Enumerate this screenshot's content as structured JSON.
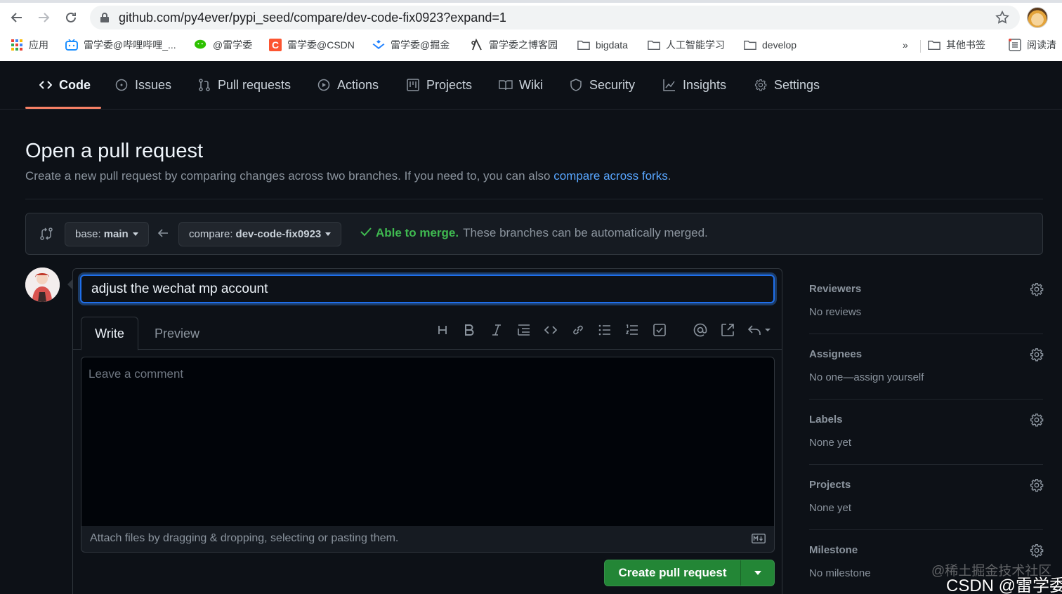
{
  "browser": {
    "url": "github.com/py4ever/pypi_seed/compare/dev-code-fix0923?expand=1",
    "bookmarks": [
      {
        "label": "应用",
        "icon": "apps-grid-icon"
      },
      {
        "label": "雷学委@哔哩哔哩_...",
        "icon": "bilibili-icon"
      },
      {
        "label": "@雷学委",
        "icon": "wechat-icon"
      },
      {
        "label": "雷学委@CSDN",
        "icon": "csdn-icon"
      },
      {
        "label": "雷学委@掘金",
        "icon": "juejin-icon"
      },
      {
        "label": "雷学委之博客园",
        "icon": "cnblogs-icon"
      },
      {
        "label": "bigdata",
        "icon": "folder-icon"
      },
      {
        "label": "人工智能学习",
        "icon": "folder-icon"
      },
      {
        "label": "develop",
        "icon": "folder-icon"
      }
    ],
    "overflow": "»",
    "other_bookmarks": "其他书签",
    "reading_list": "阅读清"
  },
  "repo_tabs": [
    {
      "label": "Code",
      "icon": "code-icon",
      "active": true
    },
    {
      "label": "Issues",
      "icon": "issue-circle-icon"
    },
    {
      "label": "Pull requests",
      "icon": "pull-request-icon"
    },
    {
      "label": "Actions",
      "icon": "play-circle-icon"
    },
    {
      "label": "Projects",
      "icon": "project-board-icon"
    },
    {
      "label": "Wiki",
      "icon": "book-icon"
    },
    {
      "label": "Security",
      "icon": "shield-icon"
    },
    {
      "label": "Insights",
      "icon": "graph-icon"
    },
    {
      "label": "Settings",
      "icon": "gear-icon"
    }
  ],
  "header": {
    "title": "Open a pull request",
    "subtitle": "Create a new pull request by comparing changes across two branches. If you need to, you can also ",
    "link": "compare across forks",
    "subtitle_end": "."
  },
  "compare": {
    "base_label": "base:",
    "base_branch": "main",
    "compare_label": "compare:",
    "compare_branch": "dev-code-fix0923",
    "status_ok": "Able to merge.",
    "status_text": "These branches can be automatically merged."
  },
  "form": {
    "title_value": "adjust the wechat mp account",
    "tab_write": "Write",
    "tab_preview": "Preview",
    "comment_placeholder": "Leave a comment",
    "attach_text": "Attach files by dragging & dropping, selecting or pasting them.",
    "submit_label": "Create pull request"
  },
  "toolbar": [
    "heading-icon",
    "bold-icon",
    "italic-icon",
    "quote-icon",
    "code-icon",
    "link-icon",
    "bulleted-list-icon",
    "numbered-list-icon",
    "task-list-icon",
    "mention-icon",
    "cross-reference-icon",
    "reply-icon"
  ],
  "sidebar": [
    {
      "heading": "Reviewers",
      "value": "No reviews"
    },
    {
      "heading": "Assignees",
      "value": "No one—assign yourself"
    },
    {
      "heading": "Labels",
      "value": "None yet"
    },
    {
      "heading": "Projects",
      "value": "None yet"
    },
    {
      "heading": "Milestone",
      "value": "No milestone"
    }
  ],
  "watermark": {
    "line1": "@稀土掘金技术社区",
    "line2": "CSDN @雷学委"
  },
  "colors": {
    "background": "#0d1117",
    "accent_blue": "#58a6ff",
    "success_green": "#3fb950",
    "primary_button": "#238636",
    "active_tab_underline": "#f78166"
  }
}
